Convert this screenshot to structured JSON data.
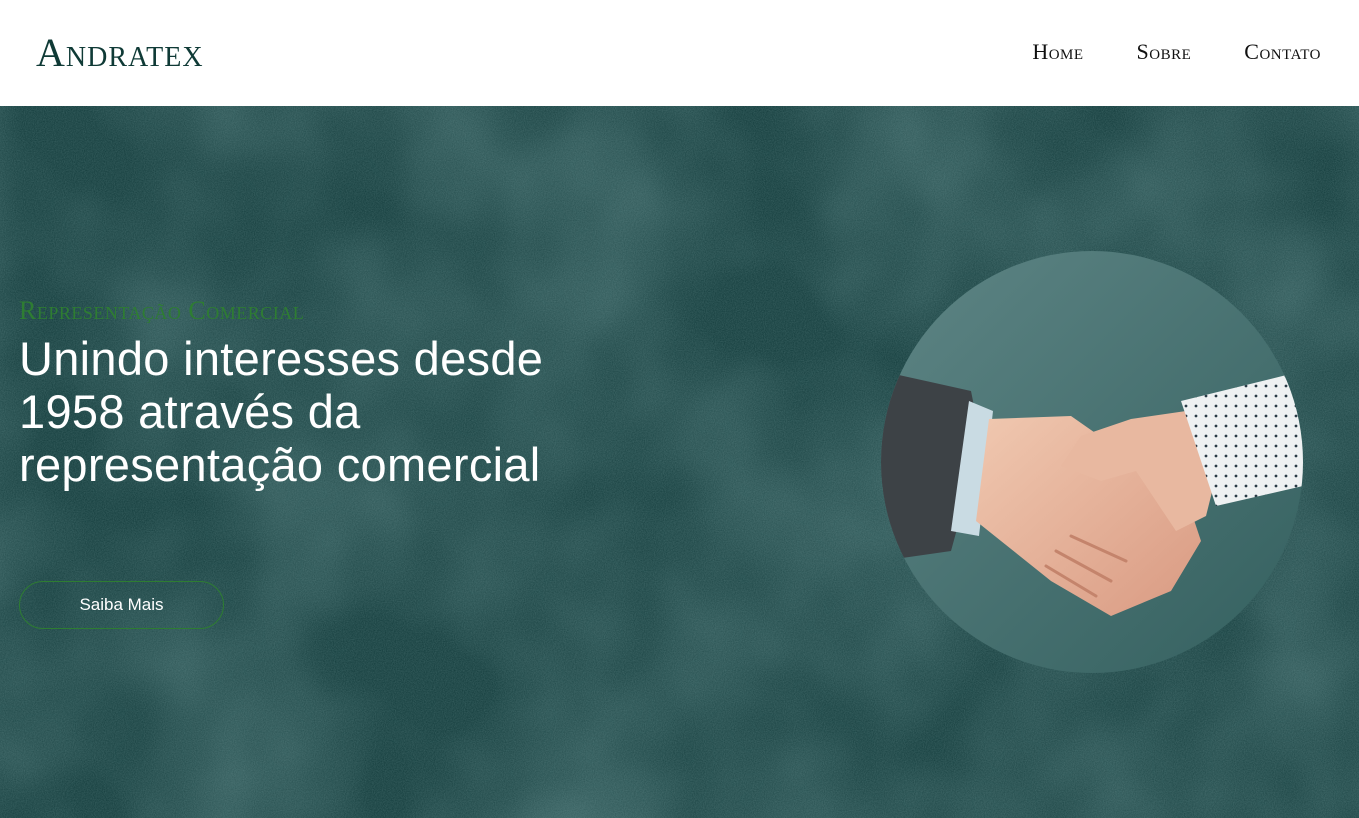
{
  "brand": {
    "name": "Andratex"
  },
  "nav": {
    "items": [
      {
        "label": "Home"
      },
      {
        "label": "Sobre"
      },
      {
        "label": "Contato"
      }
    ]
  },
  "hero": {
    "kicker": "Representação Comercial",
    "headline": "Unindo interesses desde 1958 através da representação comercial",
    "cta_label": "Saiba Mais",
    "image": "handshake-photo"
  },
  "colors": {
    "hero_bg": "#113a3a",
    "accent_green": "#2e7d32",
    "logo": "#0f3a36",
    "text_light": "#ffffff"
  }
}
